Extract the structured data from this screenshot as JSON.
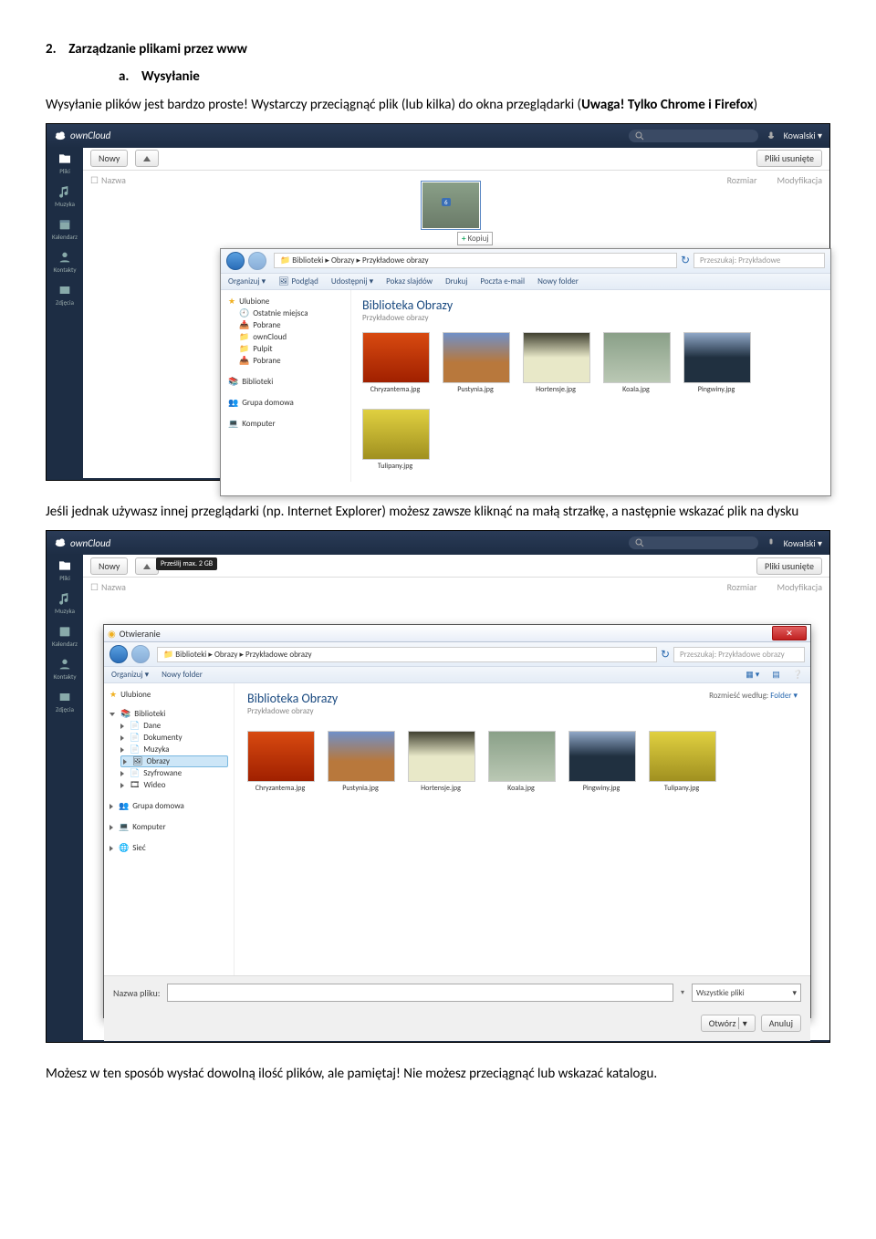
{
  "doc": {
    "heading_num": "2.",
    "heading_text": "Zarządzanie plikami przez www",
    "sub_a": "a.",
    "sub_a_text": "Wysyłanie",
    "para1_a": "Wysyłanie plików jest bardzo proste! Wystarczy przeciągnąć plik (lub kilka) do okna przeglądarki (",
    "para1_b": "Uwaga! Tylko Chrome i Firefox",
    "para1_c": ")",
    "para2": "Jeśli jednak używasz innej przeglądarki (np. Internet Explorer) możesz zawsze kliknąć na małą strzałkę, a następnie wskazać plik na dysku",
    "para3": "Możesz w ten sposób wysłać dowolną ilość plików, ale pamiętaj! Nie możesz przeciągnąć lub wskazać katalogu."
  },
  "app": {
    "logo": "ownCloud",
    "user": "Kowalski ▾",
    "btn_new": "Nowy",
    "btn_deleted": "Pliki usunięte",
    "col_name": "Nazwa",
    "col_size": "Rozmiar",
    "col_mod": "Modyfikacja",
    "nav": {
      "pliki": "Pliki",
      "muzyka": "Muzyka",
      "kalendarz": "Kalendarz",
      "kontakty": "Kontakty",
      "zdjecia": "Zdjęcia"
    },
    "copy_label": "Kopiuj",
    "drag_badge": "6",
    "upload_tooltip": "Prześlij max. 2 GB"
  },
  "explorer1": {
    "breadcrumb": "Biblioteki  ▸  Obrazy  ▸  Przykładowe obrazy",
    "search_ph": "Przeszukaj: Przykładowe",
    "toolbar": {
      "organizuj": "Organizuj ▾",
      "podglad": "Podgląd",
      "udostepnij": "Udostępnij ▾",
      "slajdy": "Pokaz slajdów",
      "drukuj": "Drukuj",
      "poczta": "Poczta e-mail",
      "nowy": "Nowy folder"
    },
    "tree": {
      "ulubione": "Ulubione",
      "ostatnie": "Ostatnie miejsca",
      "pobrane": "Pobrane",
      "owncloud": "ownCloud",
      "pulpit": "Pulpit",
      "pobrane2": "Pobrane",
      "biblioteki": "Biblioteki",
      "grupa": "Grupa domowa",
      "komputer": "Komputer"
    },
    "lib_title": "Biblioteka Obrazy",
    "lib_sub": "Przykładowe obrazy",
    "files": {
      "f1": "Chryzantema.jpg",
      "f2": "Pustynia.jpg",
      "f3": "Hortensje.jpg",
      "f4": "Koala.jpg",
      "f5": "Pingwiny.jpg",
      "f6": "Tulipany.jpg"
    }
  },
  "explorer2": {
    "title": "Otwieranie",
    "breadcrumb": "Biblioteki  ▸  Obrazy  ▸  Przykładowe obrazy",
    "search_ph": "Przeszukaj: Przykładowe obrazy",
    "toolbar": {
      "organizuj": "Organizuj ▾",
      "nowy": "Nowy folder"
    },
    "tree": {
      "ulubione": "Ulubione",
      "biblioteki": "Biblioteki",
      "dane": "Dane",
      "dokumenty": "Dokumenty",
      "muzyka": "Muzyka",
      "obrazy": "Obrazy",
      "szyfrowane": "Szyfrowane",
      "wideo": "Wideo",
      "grupa": "Grupa domowa",
      "komputer": "Komputer",
      "siec": "Sieć"
    },
    "lib_title": "Biblioteka Obrazy",
    "lib_sub": "Przykładowe obrazy",
    "sort_label": "Rozmieść według:",
    "sort_value": "Folder ▾",
    "files": {
      "f1": "Chryzantema.jpg",
      "f2": "Pustynia.jpg",
      "f3": "Hortensje.jpg",
      "f4": "Koala.jpg",
      "f5": "Pingwiny.jpg",
      "f6": "Tulipany.jpg"
    },
    "fname_label": "Nazwa pliku:",
    "filter": "Wszystkie pliki",
    "btn_open": "Otwórz",
    "btn_cancel": "Anuluj"
  }
}
